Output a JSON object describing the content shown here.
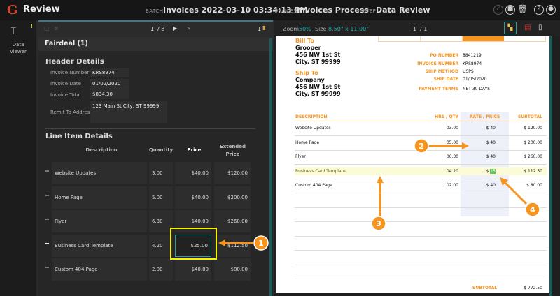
{
  "app": {
    "title": "Review",
    "logo_letter": "G"
  },
  "header": {
    "batch_label": "BATCH",
    "batch_value": "Invoices 2022-03-10 03:34:13 PM",
    "process_label": "PROCESS",
    "process_value": "Invoices Process",
    "step_label": "STEP",
    "step_value": "Data Review"
  },
  "rail": {
    "item_label_1": "Data",
    "item_label_2": "Viewer",
    "badge": "!"
  },
  "left_toolbar": {
    "page": "1",
    "page_total": "/ 8",
    "doc_count": "1"
  },
  "group": {
    "title": "Fairdeal (1)"
  },
  "header_details": {
    "title": "Header Details",
    "fields": [
      {
        "label": "Invoice Number",
        "value": "KRS8974"
      },
      {
        "label": "Invoice Date",
        "value": "01/02/2020"
      },
      {
        "label": "Invoice Total",
        "value": "$834.30"
      },
      {
        "label": "Remit To Address",
        "value": "123 Main St City, ST 99999"
      }
    ]
  },
  "line_items": {
    "title": "Line Item Details",
    "columns": [
      "Description",
      "Quantity",
      "Price",
      "Extended Price"
    ],
    "rows": [
      {
        "description": "Website Updates",
        "quantity": "3.00",
        "price": "$40.00",
        "extended": "$120.00"
      },
      {
        "description": "Home Page",
        "quantity": "5.00",
        "price": "$40.00",
        "extended": "$200.00"
      },
      {
        "description": "Flyer",
        "quantity": "6.30",
        "price": "$40.00",
        "extended": "$260.00"
      },
      {
        "description": "Business Card Template",
        "quantity": "4.20",
        "price": "$25.00",
        "extended": "$112.50"
      },
      {
        "description": "Custom 404 Page",
        "quantity": "2.00",
        "price": "$40.00",
        "extended": "$80.00"
      }
    ]
  },
  "viewer_toolbar": {
    "zoom_label": "Zoom",
    "zoom_value": "50%",
    "size_label": "Size",
    "size_value": "8.50\" x 11.00\"",
    "page": "1",
    "page_total": "/ 1"
  },
  "document": {
    "bill_to_label": "Bill To",
    "bill_to": [
      "Grooper",
      "456 NW 1st St",
      "City, ST 99999"
    ],
    "ship_to_label": "Ship To",
    "ship_to": [
      "Company",
      "456 NW 1st St",
      "City, ST 99999"
    ],
    "meta": [
      {
        "label": "PO NUMBER",
        "value": "8841219"
      },
      {
        "label": "INVOICE NUMBER",
        "value": "KRS8974"
      },
      {
        "label": "SHIP METHOD",
        "value": "USPS"
      },
      {
        "label": "SHIP DATE",
        "value": "01/05/2020"
      },
      {
        "label": "PAYMENT TERMS",
        "value": "NET 30 DAYS"
      }
    ],
    "columns": [
      "DESCRIPTION",
      "HRS / QTY",
      "RATE / PRICE",
      "SUBTOTAL"
    ],
    "rows": [
      {
        "description": "Website Updates",
        "qty": "03.00",
        "rate_prefix": "$",
        "rate": "40",
        "subtotal": "$ 120.00"
      },
      {
        "description": "Home Page",
        "qty": "05.00",
        "rate_prefix": "$",
        "rate": "40",
        "subtotal": "$ 200.00"
      },
      {
        "description": "Flyer",
        "qty": "06.30",
        "rate_prefix": "$",
        "rate": "40",
        "subtotal": "$ 260.00"
      },
      {
        "description": "Business Card Template",
        "qty": "04.20",
        "rate_prefix": "$",
        "rate": "25",
        "subtotal": "$ 112.50"
      },
      {
        "description": "Custom 404 Page",
        "qty": "02.00",
        "rate_prefix": "$",
        "rate": "40",
        "subtotal": "$ 80.00"
      }
    ],
    "subtotal_label": "SUBTOTAL",
    "subtotal_value": "$ 772.50"
  },
  "callouts": [
    "1",
    "2",
    "3",
    "4"
  ],
  "colors": {
    "accent": "#f7941d",
    "teal": "#2a9d9d",
    "highlight": "#f5f500"
  }
}
